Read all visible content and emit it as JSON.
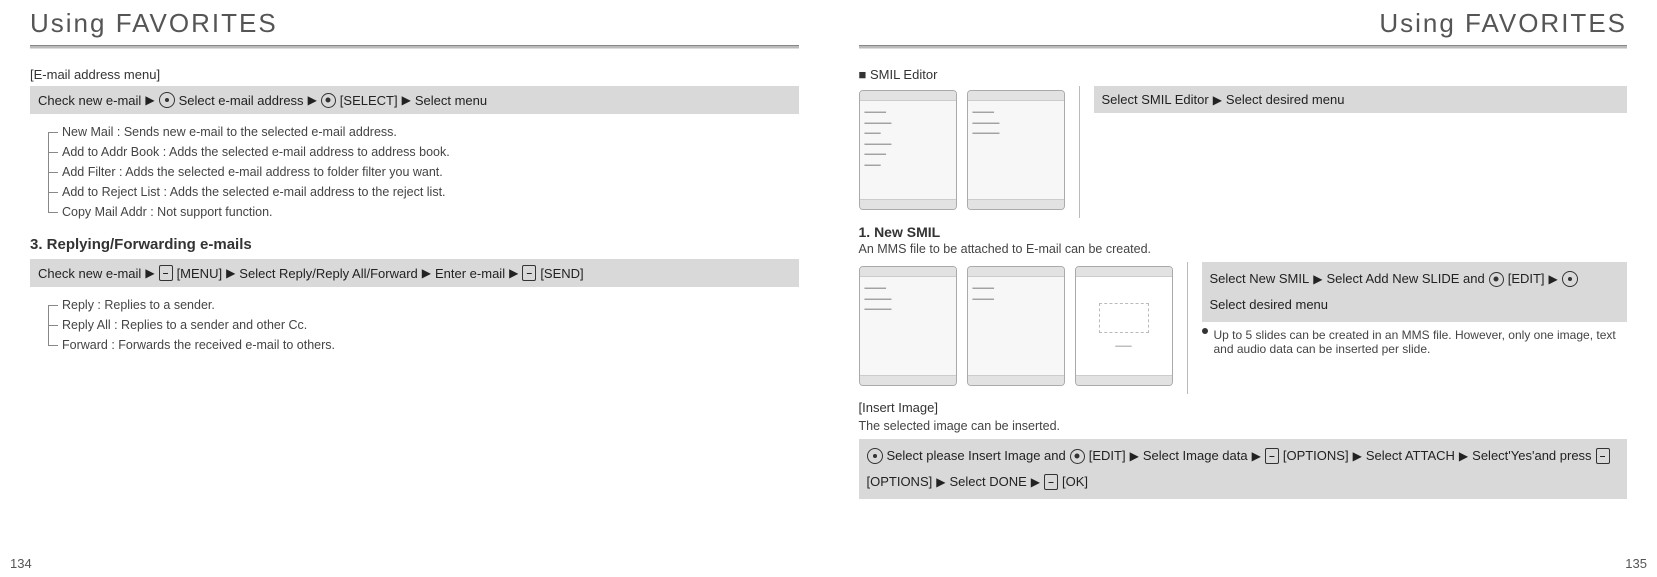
{
  "left": {
    "title": "Using FAVORITES",
    "email_menu_label": "[E-mail address menu]",
    "bar1": {
      "s1": "Check new e-mail",
      "s2": "Select e-mail address",
      "sk_select": "[SELECT]",
      "s3": "Select menu"
    },
    "list1": [
      "New Mail : Sends new e-mail to the selected e-mail address.",
      "Add to Addr Book : Adds the selected e-mail address to address book.",
      "Add Filter : Adds the selected e-mail address to folder filter you want.",
      "Add to Reject List : Adds the selected e-mail address to the reject list.",
      "Copy Mail Addr : Not support function."
    ],
    "h3": "3. Replying/Forwarding e-mails",
    "bar2": {
      "s1": "Check new e-mail",
      "sk_menu": "[MENU]",
      "s2": "Select Reply/Reply All/Forward",
      "s3": "Enter e-mail",
      "sk_send": "[SEND]"
    },
    "list2": [
      "Reply : Replies to a sender.",
      "Reply All : Replies to a sender and other Cc.",
      "Forward : Forwards the received e-mail to others."
    ],
    "page_no": "134"
  },
  "right": {
    "title": "Using FAVORITES",
    "smil_label": "■ SMIL Editor",
    "bar_smil": {
      "s1": "Select SMIL Editor",
      "s2": "Select desired menu"
    },
    "h4": "1. New SMIL",
    "desc1": "An MMS file to be attached to E-mail can be created.",
    "bar_new": {
      "s1": "Select New SMIL",
      "s2": "Select Add New SLIDE and",
      "sk_edit": "[EDIT]",
      "s3": "Select desired menu"
    },
    "note": "Up to 5 slides can be created in an MMS file. However, only one image, text and audio data can be inserted per slide.",
    "insert_label": "[Insert Image]",
    "desc2": "The selected image can be inserted.",
    "bar_insert": {
      "s1": "Select please Insert Image and",
      "sk_edit": "[EDIT]",
      "s2": "Select Image data",
      "sk_options": "[OPTIONS]",
      "s3": "Select ATTACH",
      "s4": "Select'Yes'and press",
      "sk_options2": "[OPTIONS]",
      "s5": "Select DONE",
      "sk_ok": "[OK]"
    },
    "page_no": "135"
  }
}
